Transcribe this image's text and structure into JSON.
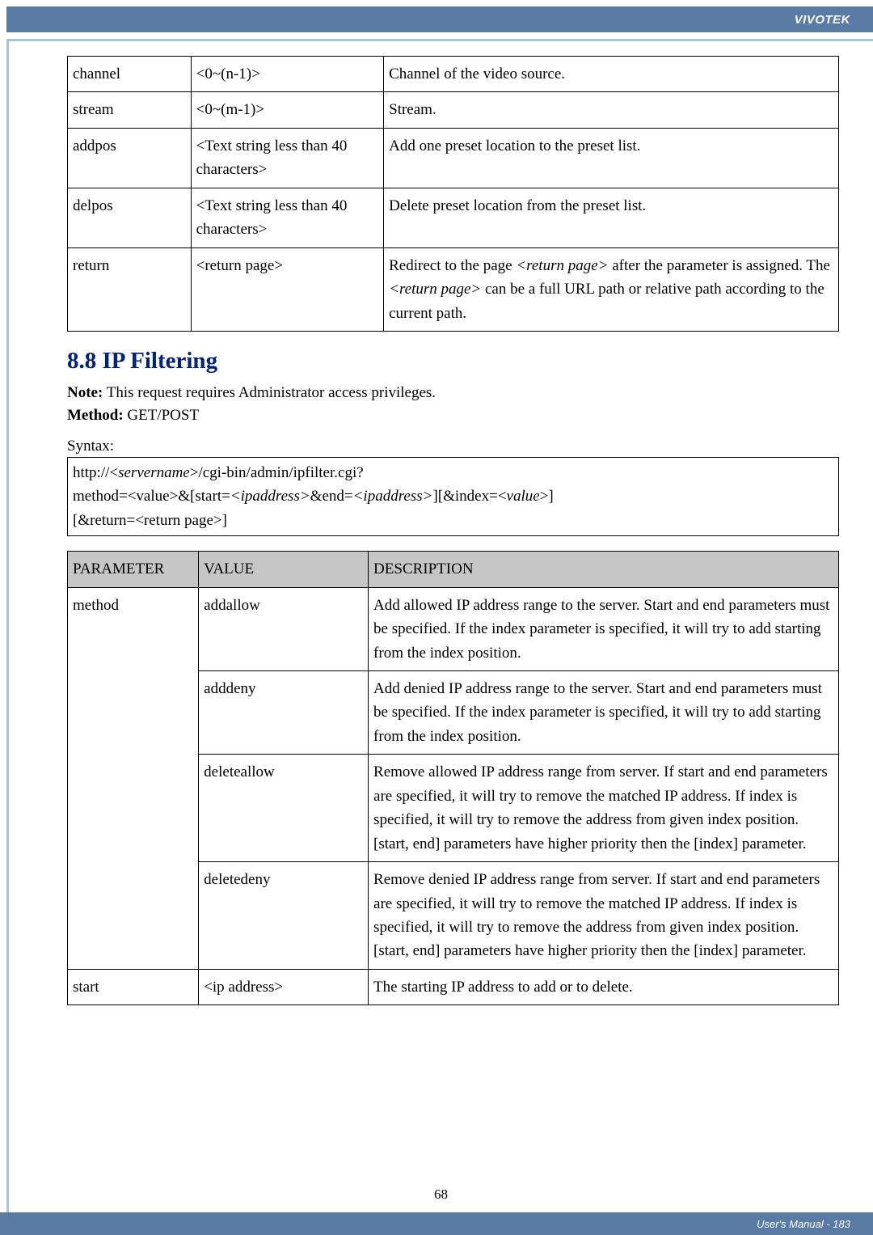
{
  "header": {
    "brand": "VIVOTEK"
  },
  "footer": {
    "right": "User's Manual - 183",
    "center": "68"
  },
  "table1": {
    "rows": [
      {
        "param": "channel",
        "value": "<0~(n-1)>",
        "desc": "Channel of the video source."
      },
      {
        "param": "stream",
        "value": "<0~(m-1)>",
        "desc": "Stream."
      },
      {
        "param": "addpos",
        "value": "<Text string less than 40 characters>",
        "desc": "Add one preset location to the preset list."
      },
      {
        "param": "delpos",
        "value": "<Text string less than 40 characters>",
        "desc": "Delete preset location from the preset list."
      },
      {
        "param": "return",
        "value": "<return page>",
        "desc_parts": {
          "a": "Redirect to the page ",
          "b": "<return page>",
          "c": " after the parameter is assigned. The ",
          "d": "<return page>",
          "e": " can be a full URL path or relative path according to the current path."
        }
      }
    ]
  },
  "section": {
    "title": "8.8 IP Filtering",
    "note_label": "Note:",
    "note_text": " This request requires Administrator access privileges.",
    "method_label": "Method:",
    "method_text": " GET/POST",
    "syntax_label": "Syntax:",
    "syntax_parts": {
      "l1a": "http://<",
      "l1b": "servername",
      "l1c": ">/cgi-bin/admin/ipfilter.cgi?",
      "l2a": "method=<value>&[start=",
      "l2b": "<ipaddress>",
      "l2c": "&end=",
      "l2d": "<ipaddress>",
      "l2e": "][&index=<",
      "l2f": "value",
      "l2g": ">]",
      "l3": "[&return=<return page>]"
    }
  },
  "table2": {
    "headers": {
      "c1": "PARAMETER",
      "c2": "VALUE",
      "c3": "DESCRIPTION"
    },
    "rows": {
      "r1": {
        "param": "method",
        "v1": "addallow",
        "d1": "Add allowed IP address range to the server. Start and end parameters must be specified. If the index parameter is specified, it will try to add starting from the index position.",
        "v2": "adddeny",
        "d2": "Add denied IP address range to the server. Start and end parameters must be specified. If the index parameter is specified, it will try to add starting from the index position.",
        "v3": "deleteallow",
        "d3": "Remove allowed IP address range from server. If start and end parameters are specified, it will try to remove the matched IP address. If index is specified, it will try to remove the address from given index position. [start, end] parameters have higher priority then the [index] parameter.",
        "v4": "deletedeny",
        "d4": "Remove denied IP address range from server. If start and end parameters are specified, it will try to remove the matched IP address. If index is specified, it will try to remove the address from given index position. [start, end] parameters have higher priority then the [index] parameter."
      },
      "r2": {
        "param": "start",
        "value": "<ip address>",
        "desc": "The starting IP address to add or to delete."
      }
    }
  }
}
